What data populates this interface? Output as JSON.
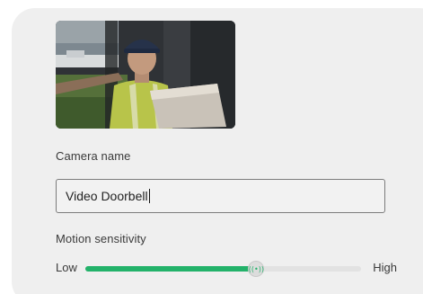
{
  "camera": {
    "preview_alt": "Video Doorbell camera preview",
    "name_label": "Camera name",
    "name_value": "Video Doorbell"
  },
  "motion": {
    "label": "Motion sensitivity",
    "low_label": "Low",
    "high_label": "High",
    "level_fraction": 0.62,
    "thumb_icon": "motion-signal-icon",
    "accent_color": "#23b26a"
  }
}
